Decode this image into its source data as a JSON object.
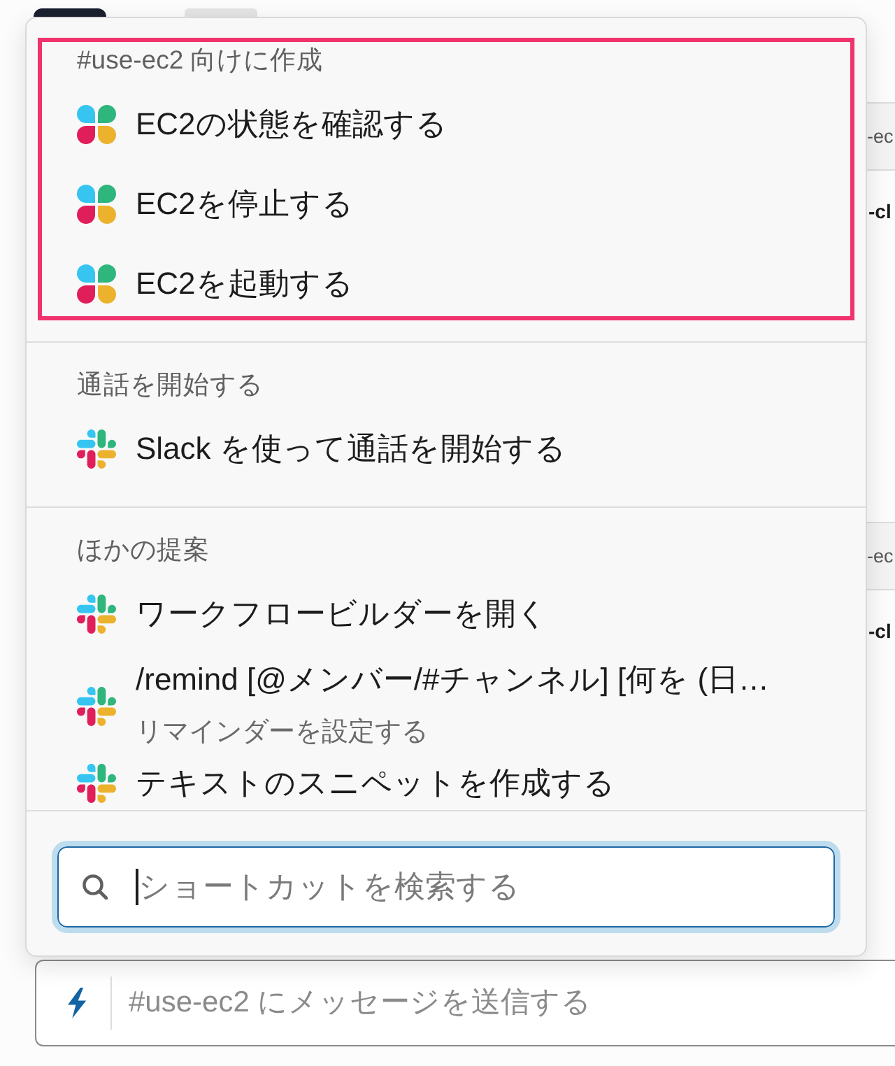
{
  "shortcuts_menu": {
    "sections": [
      {
        "title": "#use-ec2 向けに作成",
        "highlighted": true,
        "items": [
          {
            "kind": "workflow",
            "label": "EC2の状態を確認する",
            "selected": false
          },
          {
            "kind": "workflow",
            "label": "EC2を停止する",
            "selected": false
          },
          {
            "kind": "workflow",
            "label": "EC2を起動する",
            "selected": false
          }
        ]
      },
      {
        "title": "通話を開始する",
        "highlighted": false,
        "items": [
          {
            "kind": "app",
            "label": "Slack を使って通話を開始する",
            "selected": false
          }
        ]
      },
      {
        "title": "ほかの提案",
        "highlighted": false,
        "items": [
          {
            "kind": "app",
            "label": "ワークフロービルダーを開く",
            "selected": false
          },
          {
            "kind": "app",
            "label": "/remind [@メンバー/#チャンネル] [何を (日…",
            "description": "リマインダーを設定する",
            "selected": false
          },
          {
            "kind": "app",
            "label": "テキストのスニペットを作成する",
            "selected": false
          }
        ]
      }
    ],
    "search": {
      "placeholder": "ショートカットを検索する",
      "focused": true
    }
  },
  "background_messages": [
    {
      "preview": "-ec",
      "title": "-cl"
    },
    {
      "preview": "-ec",
      "title": "-cl"
    }
  ],
  "composer": {
    "placeholder": "#use-ec2 にメッセージを送信する"
  }
}
